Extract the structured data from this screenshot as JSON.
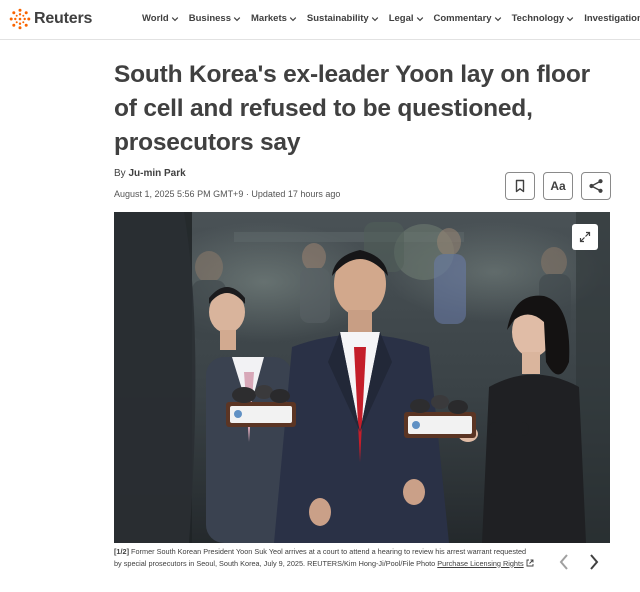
{
  "site": {
    "name": "Reuters",
    "brand_color": "#fa6400"
  },
  "nav": {
    "items": [
      {
        "label": "World",
        "has_dropdown": true
      },
      {
        "label": "Business",
        "has_dropdown": true
      },
      {
        "label": "Markets",
        "has_dropdown": true
      },
      {
        "label": "Sustainability",
        "has_dropdown": true
      },
      {
        "label": "Legal",
        "has_dropdown": true
      },
      {
        "label": "Commentary",
        "has_dropdown": true
      },
      {
        "label": "Technology",
        "has_dropdown": true
      },
      {
        "label": "Investigations",
        "has_dropdown": false
      }
    ]
  },
  "article": {
    "headline_lines": [
      "South Korea's ex-leader Yoon lay on floor",
      "of cell and refused to be questioned,",
      "prosecutors say"
    ],
    "byline_prefix": "By",
    "author": "Ju-min Park",
    "dateline": "August 1, 2025 5:56 PM GMT+9 · Updated 17 hours ago"
  },
  "tools": {
    "bookmark_icon": "bookmark-icon",
    "text_size_label": "Aa",
    "share_icon": "share-icon"
  },
  "photo": {
    "expand_icon": "expand-icon",
    "microphone_logo_text": "한국영상기자협회",
    "caption": {
      "counter": "[1/2]",
      "text": "Former South Korean President Yoon Suk Yeol arrives at a court to attend a hearing to review his arrest warrant requested by special prosecutors in Seoul, South Korea, July 9, 2025. REUTERS/Kim Hong-Ji/Pool/File Photo",
      "link_text": "Purchase Licensing Rights"
    }
  }
}
